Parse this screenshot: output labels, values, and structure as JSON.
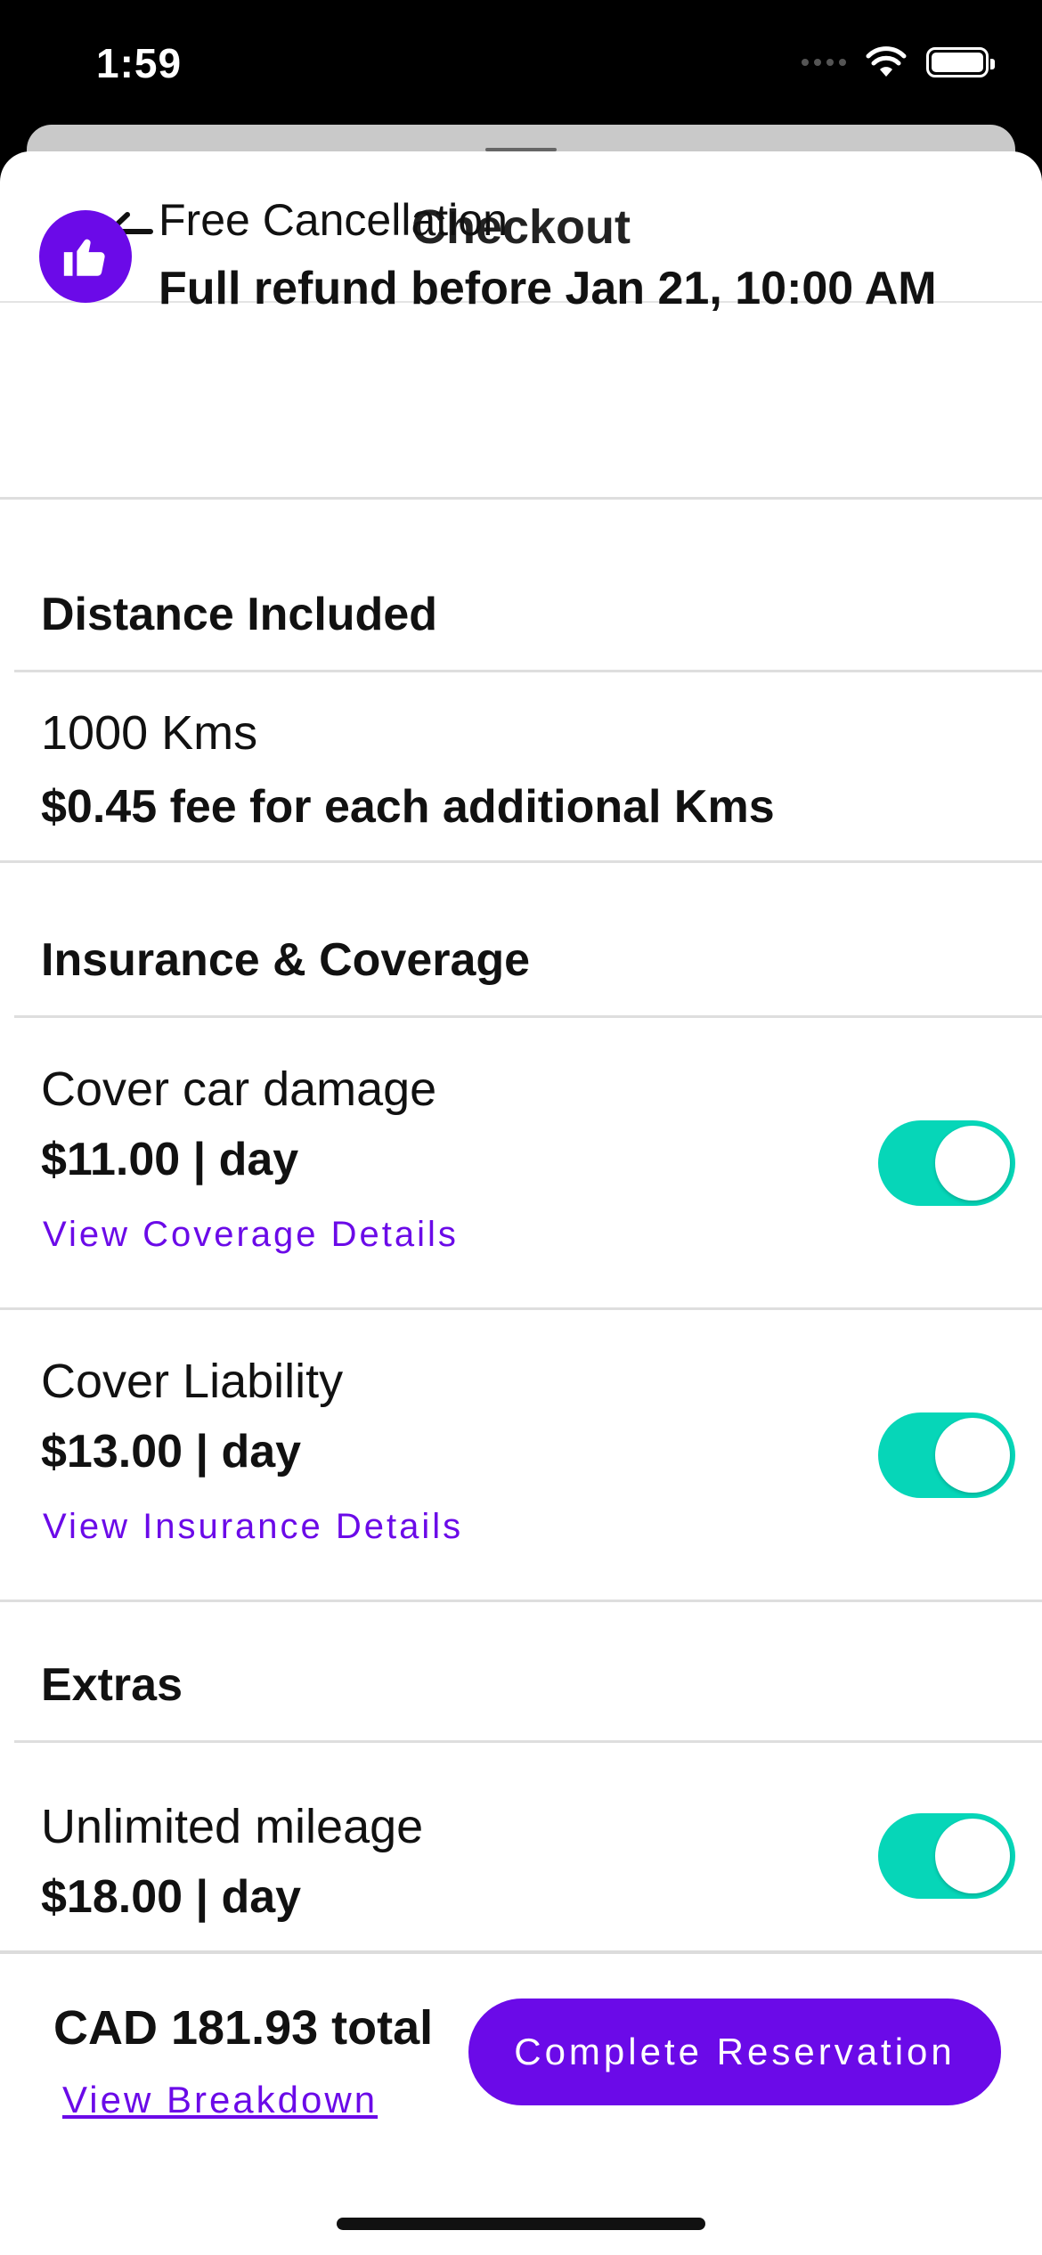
{
  "status_bar": {
    "time": "1:59"
  },
  "header": {
    "title": "Checkout"
  },
  "free_cancellation": {
    "title": "Free Cancellation",
    "subtitle": "Full refund before Jan 21, 10:00 AM"
  },
  "distance": {
    "section_title": "Distance Included",
    "amount": "1000 Kms",
    "fee": "$0.45 fee for each additional Kms"
  },
  "insurance": {
    "section_title": "Insurance & Coverage",
    "items": [
      {
        "label": "Cover car damage",
        "price": "$11.00 | day",
        "link": "View Coverage Details",
        "enabled": true
      },
      {
        "label": "Cover Liability",
        "price": "$13.00 | day",
        "link": "View Insurance Details",
        "enabled": true
      }
    ]
  },
  "extras": {
    "section_title": "Extras",
    "items": [
      {
        "label": "Unlimited mileage",
        "price": "$18.00 | day",
        "enabled": true
      }
    ]
  },
  "footer": {
    "total": "CAD 181.93 total",
    "breakdown_link": "View Breakdown",
    "cta_label": "Complete Reservation"
  },
  "colors": {
    "accent": "#6b0ae8",
    "toggle_on": "#06d6b8"
  }
}
